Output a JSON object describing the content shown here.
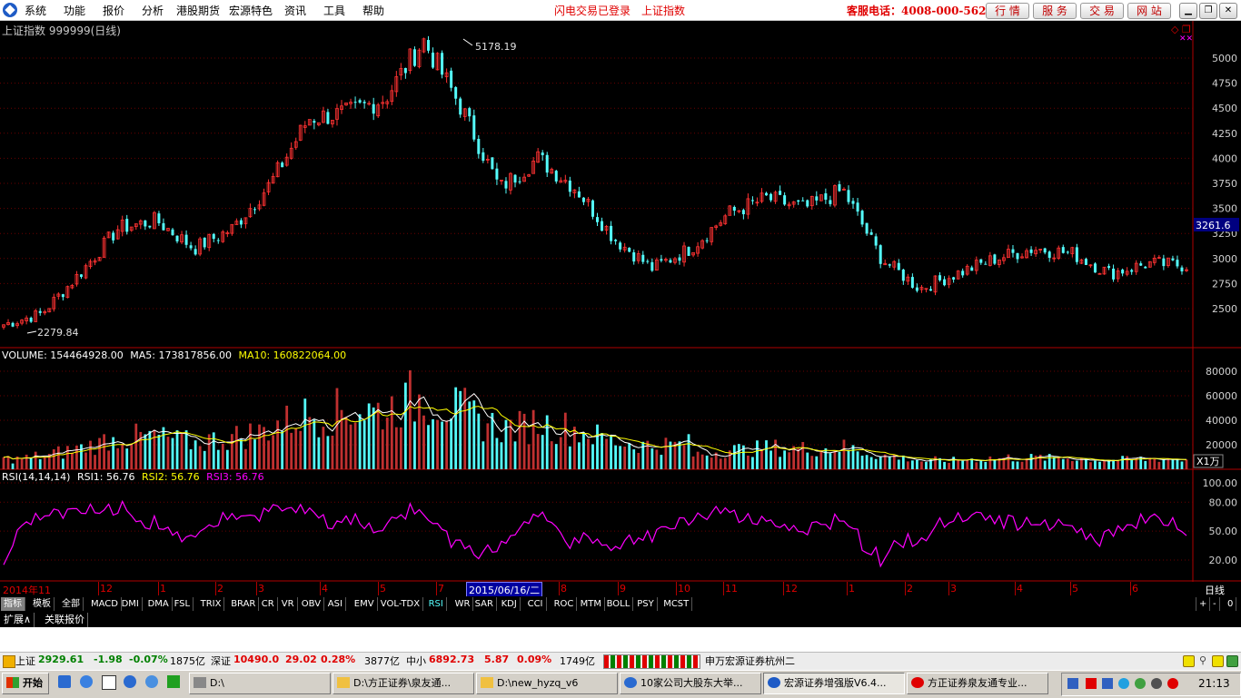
{
  "menubar": {
    "items": [
      "系统",
      "功能",
      "报价",
      "分析",
      "港股期货",
      "宏源特色",
      "资讯",
      "工具",
      "帮助"
    ],
    "flash_login": "闪电交易已登录",
    "current_index": "上证指数",
    "hotline": "客服电话：4008-000-562",
    "buttons": [
      "行 情",
      "服 务",
      "交 易",
      "网 站"
    ]
  },
  "chart": {
    "title": "上证指数 999999(日线)",
    "high_label": "5178.19",
    "low_label": "2279.84",
    "current_price": "3261.6",
    "price_ticks": [
      "5000",
      "4750",
      "4500",
      "4250",
      "4000",
      "3750",
      "3500",
      "3250",
      "3000",
      "2750",
      "2500"
    ],
    "volume_legend": {
      "vol": "VOLUME: 154464928.00",
      "ma5": "MA5: 173817856.00",
      "ma10": "MA10: 160822064.00"
    },
    "volume_ticks": [
      "80000",
      "60000",
      "40000",
      "20000"
    ],
    "volume_unit": "X1万",
    "rsi_legend": {
      "name": "RSI(14,14,14)",
      "rsi1": "RSI1: 56.76",
      "rsi2": "RSI2: 56.76",
      "rsi3": "RSI3: 56.76"
    },
    "rsi_ticks": [
      "100.00",
      "80.00",
      "50.00",
      "20.00"
    ],
    "time_axis": {
      "start": "2014年11",
      "months": [
        "12",
        "1",
        "2",
        "3",
        "4",
        "5",
        "6",
        "7",
        "8",
        "9",
        "10",
        "11",
        "12",
        "1",
        "2",
        "3",
        "4",
        "5",
        "6"
      ],
      "cursor_date": "2015/06/16/二",
      "period": "日线"
    },
    "colors": {
      "up": "#ff3232",
      "down": "#54fcfc",
      "ma5": "#ffffff",
      "ma10": "#ffff00",
      "rsi": "#ff00ff"
    }
  },
  "chart_data": {
    "type": "candlestick",
    "title": "上证指数 999999(日线)",
    "ylim": [
      2200,
      5300
    ],
    "series": [
      {
        "name": "上证指数",
        "close_approx": [
          2340,
          2450,
          2850,
          3300,
          3380,
          3100,
          3300,
          3750,
          4400,
          4450,
          4600,
          5178,
          4500,
          3700,
          4000,
          3700,
          3200,
          2900,
          3100,
          3450,
          3600,
          3500,
          3680,
          3000,
          2700,
          2850,
          3000,
          3100,
          3050,
          2850,
          2950,
          2930
        ]
      }
    ],
    "high": 5178.19,
    "low": 2279.84,
    "last": 3261.6
  },
  "tabs": [
    "指标",
    "模板",
    "全部",
    "MACD",
    "DMI",
    "DMA",
    "FSL",
    "TRIX",
    "BRAR",
    "CR",
    "VR",
    "OBV",
    "ASI",
    "EMV",
    "VOL-TDX",
    "RSI",
    "WR",
    "SAR",
    "KDJ",
    "CCI",
    "ROC",
    "MTM",
    "BOLL",
    "PSY",
    "MCST"
  ],
  "tab_controls": [
    "+",
    "-",
    "0"
  ],
  "ext_tabs": [
    "扩展∧",
    "关联报价"
  ],
  "status": {
    "sh_label": "上证",
    "sh_price": "2929.61",
    "sh_change": "-1.98",
    "sh_pct": "-0.07%",
    "sh_amount": "1875亿",
    "sz_label": "深证",
    "sz_price": "10490.0",
    "sz_change": "29.02",
    "sz_pct": "0.28%",
    "sz_amount": "3877亿",
    "zx_label": "中小",
    "zx_price": "6892.73",
    "zx_change": "5.87",
    "zx_pct": "0.09%",
    "zx_amount": "1749亿",
    "broker": "申万宏源证券杭州二"
  },
  "taskbar": {
    "start": "开始",
    "tasks": [
      "D:\\",
      "D:\\方正证券\\泉友通...",
      "D:\\new_hyzq_v6",
      "10家公司大股东大举...",
      "宏源证券增强版V6.4...",
      "方正证券泉友通专业..."
    ],
    "clock": "21:13"
  }
}
